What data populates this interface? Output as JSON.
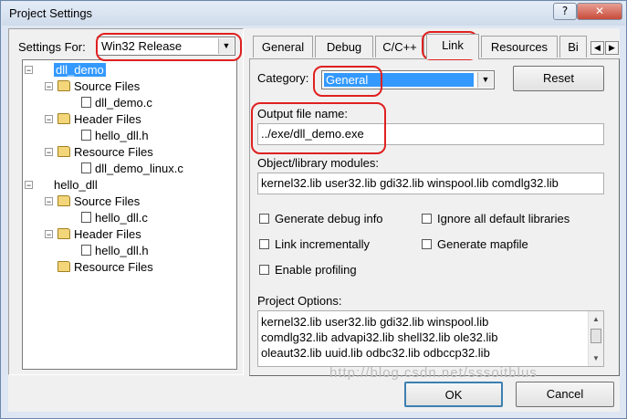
{
  "window": {
    "title": "Project Settings",
    "help_label": "?",
    "close_label": "✕"
  },
  "settings_for": {
    "label": "Settings For:",
    "value": "Win32 Release"
  },
  "tree": [
    {
      "label": "dll_demo",
      "kind": "project",
      "level": 0,
      "expanded": true,
      "selected": true
    },
    {
      "label": "Source Files",
      "kind": "folder",
      "level": 1,
      "expanded": true
    },
    {
      "label": "dll_demo.c",
      "kind": "file",
      "level": 2
    },
    {
      "label": "Header Files",
      "kind": "folder",
      "level": 1,
      "expanded": true
    },
    {
      "label": "hello_dll.h",
      "kind": "file",
      "level": 2
    },
    {
      "label": "Resource Files",
      "kind": "folder",
      "level": 1,
      "expanded": true
    },
    {
      "label": "dll_demo_linux.c",
      "kind": "file",
      "level": 2
    },
    {
      "label": "hello_dll",
      "kind": "project",
      "level": 0,
      "expanded": true
    },
    {
      "label": "Source Files",
      "kind": "folder",
      "level": 1,
      "expanded": true
    },
    {
      "label": "hello_dll.c",
      "kind": "file",
      "level": 2
    },
    {
      "label": "Header Files",
      "kind": "folder",
      "level": 1,
      "expanded": true
    },
    {
      "label": "hello_dll.h",
      "kind": "file",
      "level": 2
    },
    {
      "label": "Resource Files",
      "kind": "folder",
      "level": 1,
      "expanded": false
    }
  ],
  "tabs": [
    "General",
    "Debug",
    "C/C++",
    "Link",
    "Resources",
    "Bi"
  ],
  "active_tab": "Link",
  "link": {
    "category_label": "Category:",
    "category_value": "General",
    "reset_label": "Reset",
    "output_label": "Output file name:",
    "output_value": "../exe/dll_demo.exe",
    "modules_label": "Object/library modules:",
    "modules_value": "kernel32.lib user32.lib gdi32.lib winspool.lib comdlg32.lib",
    "checkboxes": {
      "debug_info": "Generate debug info",
      "ignore_libs": "Ignore all default libraries",
      "link_inc": "Link incrementally",
      "mapfile": "Generate mapfile",
      "profiling": "Enable profiling"
    },
    "options_label": "Project Options:",
    "options_lines": [
      "kernel32.lib user32.lib gdi32.lib winspool.lib",
      "comdlg32.lib advapi32.lib shell32.lib ole32.lib",
      "oleaut32.lib uuid.lib odbc32.lib odbccp32.lib"
    ]
  },
  "buttons": {
    "ok": "OK",
    "cancel": "Cancel"
  },
  "watermark": "http://blog.csdn.net/sssoitblus"
}
